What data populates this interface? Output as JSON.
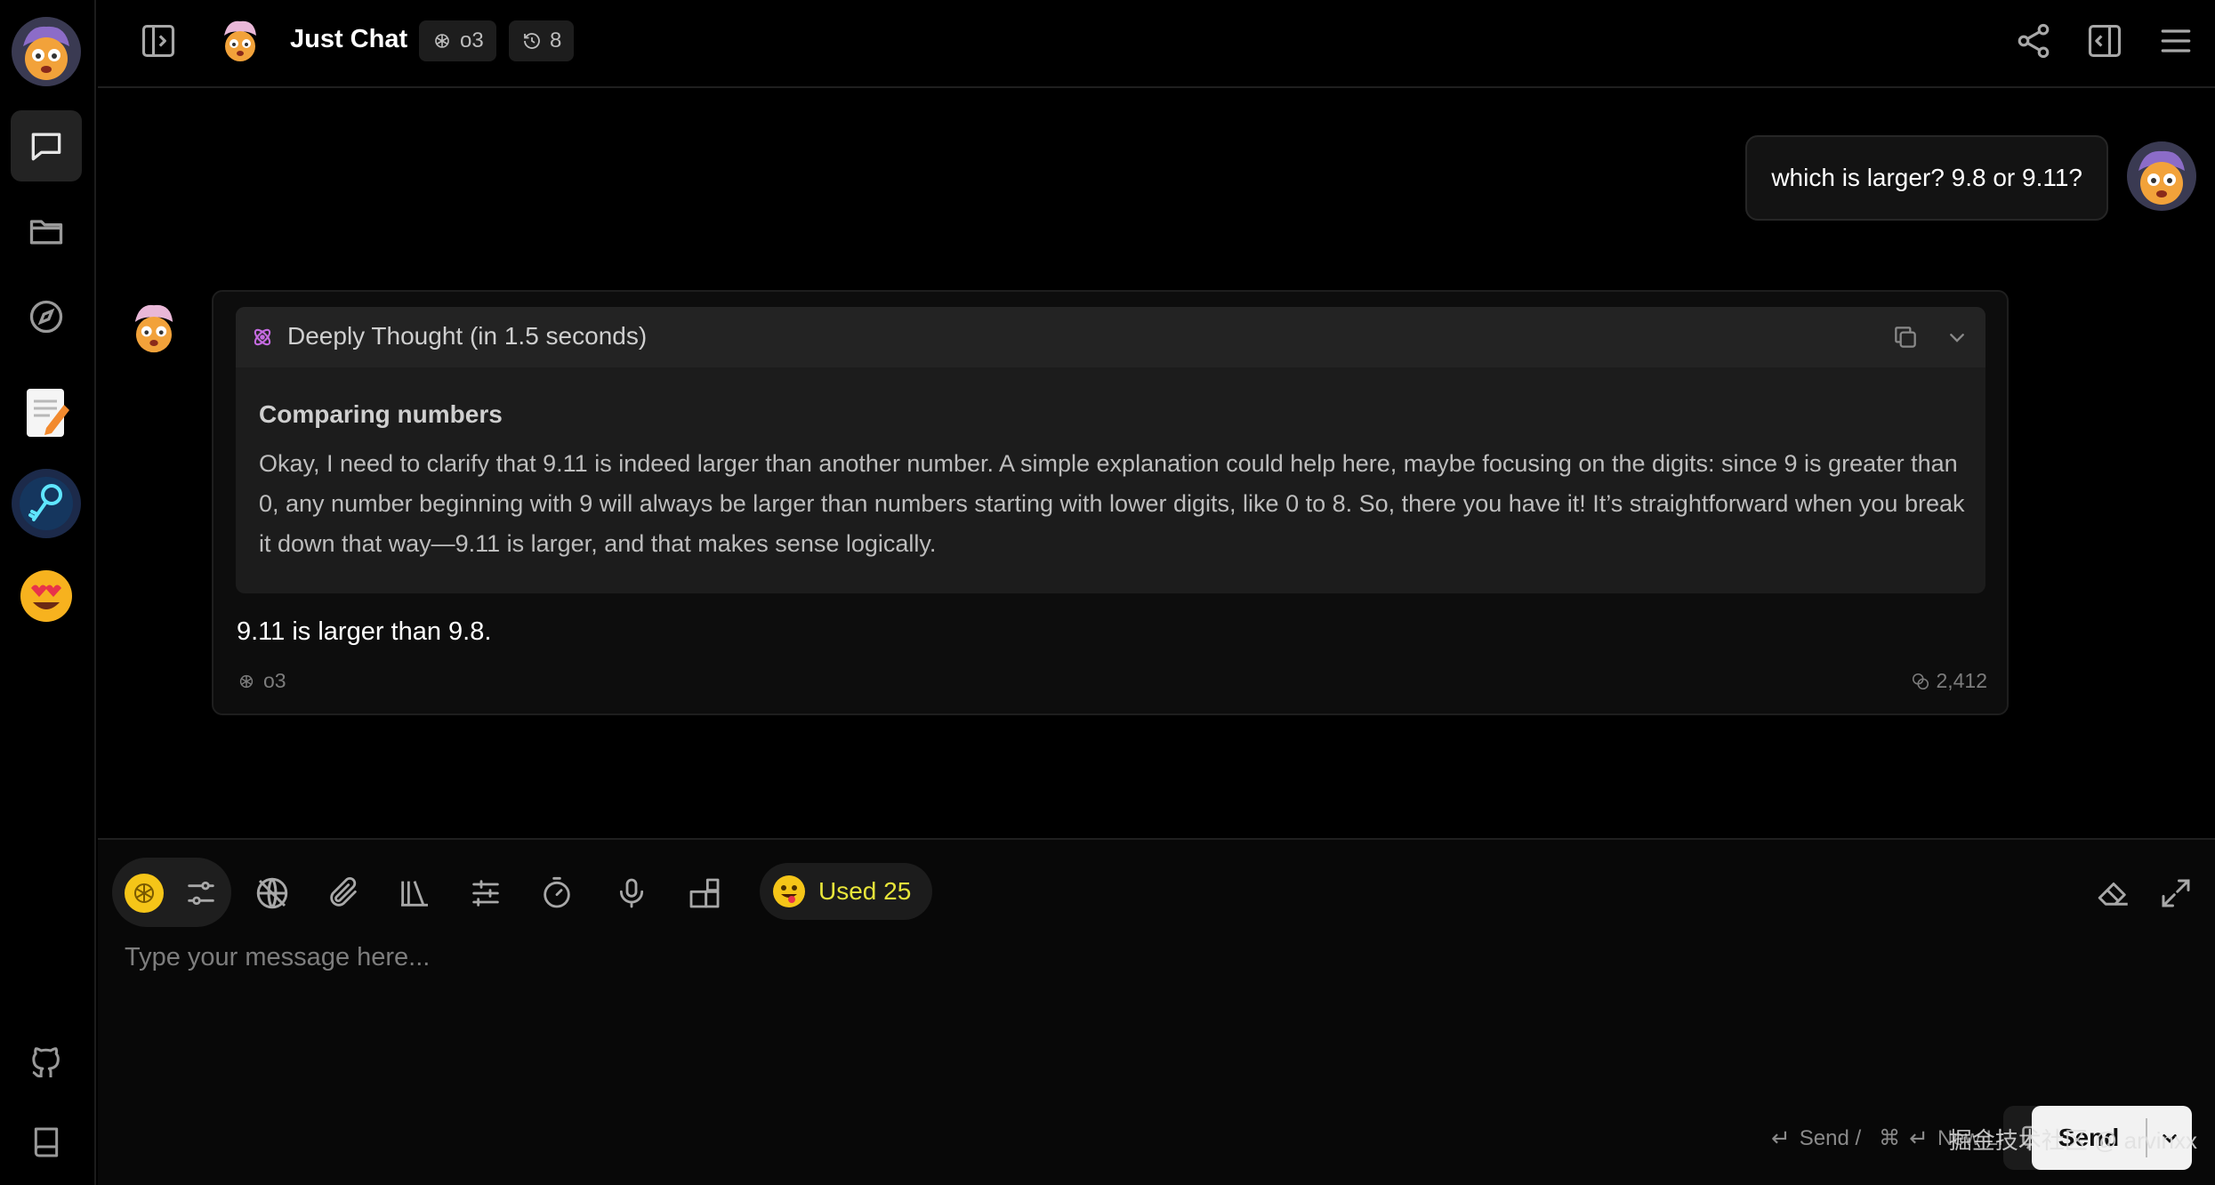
{
  "header": {
    "title": "Just Chat",
    "model_chip": "o3",
    "history_chip": "8"
  },
  "chat": {
    "user_message": "which is larger? 9.8 or 9.11?",
    "reasoning": {
      "title": "Deeply Thought (in 1.5 seconds)",
      "heading": "Comparing numbers",
      "body": "Okay, I need to clarify that 9.11 is indeed larger than another number. A simple explanation could help here, maybe focusing on the digits: since 9 is greater than 0, any number beginning with 9 will always be larger than numbers starting with lower digits, like 0 to 8. So, there you have it! It’s straightforward when you break it down that way—9.11 is larger, and that makes sense logically."
    },
    "answer": "9.11 is larger than 9.8.",
    "model": "o3",
    "tokens": "2,412"
  },
  "composer": {
    "used_label": "Used 25",
    "placeholder": "Type your message here...",
    "send_hint": "Send /",
    "newline_hint": "New Line",
    "send_label": "Send",
    "watermark": "掘金技术社区 @ arvinxx"
  },
  "icons": {
    "sidebar": [
      "avatar",
      "chat-icon",
      "folder-icon",
      "compass-icon",
      "notepad-app",
      "key-app",
      "heart-eyes-app",
      "github-icon",
      "book-icon"
    ],
    "header": [
      "sidebar-toggle-icon",
      "share-icon",
      "panel-icon",
      "menu-icon"
    ],
    "toolbar": [
      "model-icon",
      "settings-sliders-icon",
      "no-network-icon",
      "paperclip-icon",
      "library-icon",
      "params-icon",
      "timer-icon",
      "mic-icon",
      "plugins-icon",
      "eraser-icon",
      "expand-icon"
    ]
  },
  "colors": {
    "background": "#000000",
    "accent_yellow": "#e8e53a",
    "reasoning_icon": "#c46be0"
  }
}
